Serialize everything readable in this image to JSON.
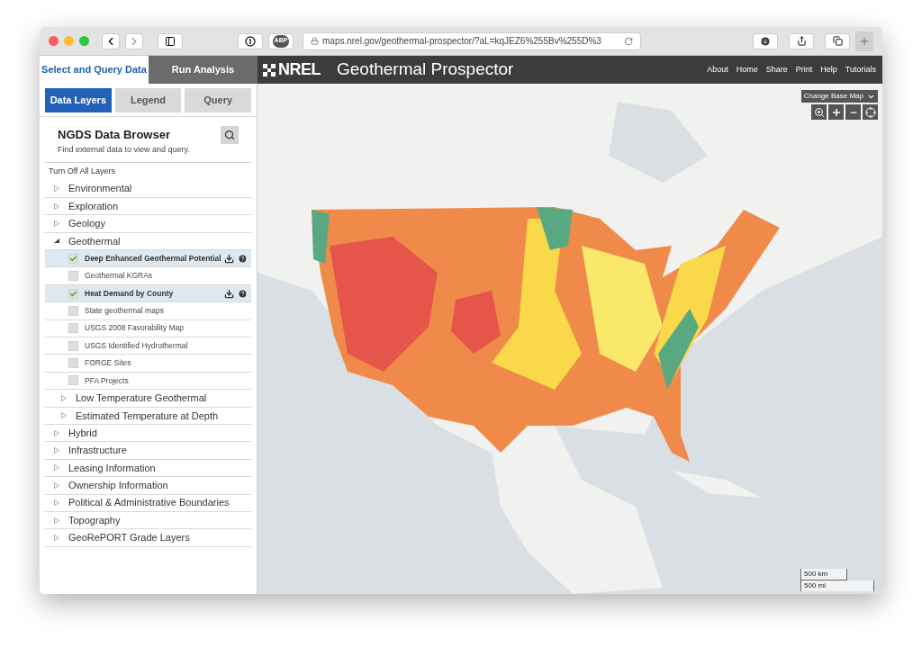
{
  "browser": {
    "url": "maps.nrel.gov/geothermal-prospector/?aL=kqJEZ6%255Bv%255D%3",
    "adblock_badge": "ABP"
  },
  "header": {
    "panel_tabs": [
      {
        "label": "Select and Query Data",
        "selected": true
      },
      {
        "label": "Run Analysis",
        "selected": false
      }
    ],
    "logo": "NREL",
    "title": "Geothermal Prospector",
    "nav": [
      "About",
      "Home",
      "Share",
      "Print",
      "Help",
      "Tutorials"
    ]
  },
  "sub_tabs": [
    {
      "label": "Data Layers",
      "selected": true
    },
    {
      "label": "Legend",
      "selected": false
    },
    {
      "label": "Query",
      "selected": false
    }
  ],
  "data_browser": {
    "title": "NGDS Data Browser",
    "subtitle": "Find external data to view and query.",
    "turn_off": "Turn Off All Layers"
  },
  "layers": [
    {
      "kind": "group",
      "label": "Environmental",
      "expanded": false
    },
    {
      "kind": "group",
      "label": "Exploration",
      "expanded": false
    },
    {
      "kind": "group",
      "label": "Geology",
      "expanded": false
    },
    {
      "kind": "group",
      "label": "Geothermal",
      "expanded": true,
      "children": [
        {
          "kind": "layer",
          "label": "Deep Enhanced Geothermal Potential",
          "checked": true
        },
        {
          "kind": "layer",
          "label": "Geothermal KGRAs",
          "checked": false
        },
        {
          "kind": "layer",
          "label": "Heat Demand by County",
          "checked": true
        },
        {
          "kind": "layer",
          "label": "State geothermal maps",
          "checked": false
        },
        {
          "kind": "layer",
          "label": "USGS 2008 Favorability Map",
          "checked": false
        },
        {
          "kind": "layer",
          "label": "USGS Identified Hydrothermal",
          "checked": false
        },
        {
          "kind": "layer",
          "label": "FORGE Sites",
          "checked": false
        },
        {
          "kind": "layer",
          "label": "PFA Projects",
          "checked": false
        },
        {
          "kind": "group",
          "label": "Low Temperature Geothermal",
          "expanded": false
        },
        {
          "kind": "group",
          "label": "Estimated Temperature at Depth",
          "expanded": false
        }
      ]
    },
    {
      "kind": "group",
      "label": "Hybrid",
      "expanded": false
    },
    {
      "kind": "group",
      "label": "Infrastructure",
      "expanded": false
    },
    {
      "kind": "group",
      "label": "Leasing Information",
      "expanded": false
    },
    {
      "kind": "group",
      "label": "Ownership Information",
      "expanded": false
    },
    {
      "kind": "group",
      "label": "Political & Administrative Boundaries",
      "expanded": false
    },
    {
      "kind": "group",
      "label": "Topography",
      "expanded": false
    },
    {
      "kind": "group",
      "label": "GeoRePORT Grade Layers",
      "expanded": false
    }
  ],
  "map": {
    "base_map_button": "Change Base Map",
    "scale": [
      "500 km",
      "500 mi"
    ]
  }
}
